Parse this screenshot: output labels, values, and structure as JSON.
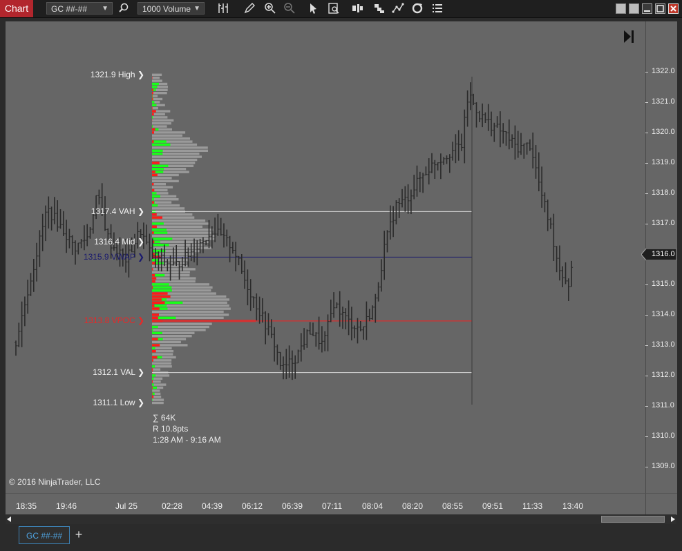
{
  "toolbar": {
    "chart_label": "Chart",
    "instrument": "GC ##-##",
    "interval": "1000 Volume",
    "icons": [
      "search-icon",
      "bar-type-icon",
      "pencil-icon",
      "zoom-in-icon",
      "zoom-out-icon",
      "pointer-icon",
      "data-box-icon",
      "stack-bars-icon",
      "stack-icon",
      "strategy-icon",
      "reload-icon",
      "properties-icon"
    ],
    "window_buttons": [
      "tile-icon",
      "restore-small-icon",
      "minimize-icon",
      "maximize-icon",
      "close-icon"
    ]
  },
  "chart": {
    "f_button": "F",
    "copyright": "© 2016 NinjaTrader, LLC",
    "profile_labels": {
      "high": "1321.9 High",
      "vah": "1317.4 VAH",
      "mid": "1316.4 Mid",
      "vwap": "1315.9 VWAP",
      "vpoc": "1313.8 VPOC",
      "val": "1312.1 VAL",
      "low": "1311.1 Low"
    },
    "stats": {
      "volume": "∑ 64K",
      "range": "R 10.8pts",
      "time_range": "1:28 AM - 9:16 AM"
    },
    "current_price": "1316.0",
    "colors": {
      "background": "#666666",
      "buy": "#19ff19",
      "sell": "#ff1a1a",
      "vpoc": "#d23232",
      "vwap": "#1a1a6e",
      "bars": "#2a2a2a"
    }
  },
  "chart_data": {
    "type": "candlestick",
    "price_axis": [
      "1322.0",
      "1321.0",
      "1320.0",
      "1319.0",
      "1318.0",
      "1317.0",
      "1316.0",
      "1315.0",
      "1314.0",
      "1313.0",
      "1312.0",
      "1311.0",
      "1310.0",
      "1309.0"
    ],
    "time_axis": [
      "18:35",
      "19:46",
      "Jul 25",
      "02:28",
      "04:39",
      "06:12",
      "06:39",
      "07:11",
      "08:04",
      "08:20",
      "08:55",
      "09:51",
      "11:33",
      "13:40"
    ],
    "ylim": [
      1308.4,
      1323.0
    ],
    "levels": {
      "high": 1321.9,
      "vah": 1317.4,
      "mid": 1316.4,
      "vwap": 1315.9,
      "vpoc": 1313.8,
      "val": 1312.1,
      "low": 1311.1
    }
  },
  "tabs": {
    "active": "GC ##-##",
    "add": "+"
  }
}
